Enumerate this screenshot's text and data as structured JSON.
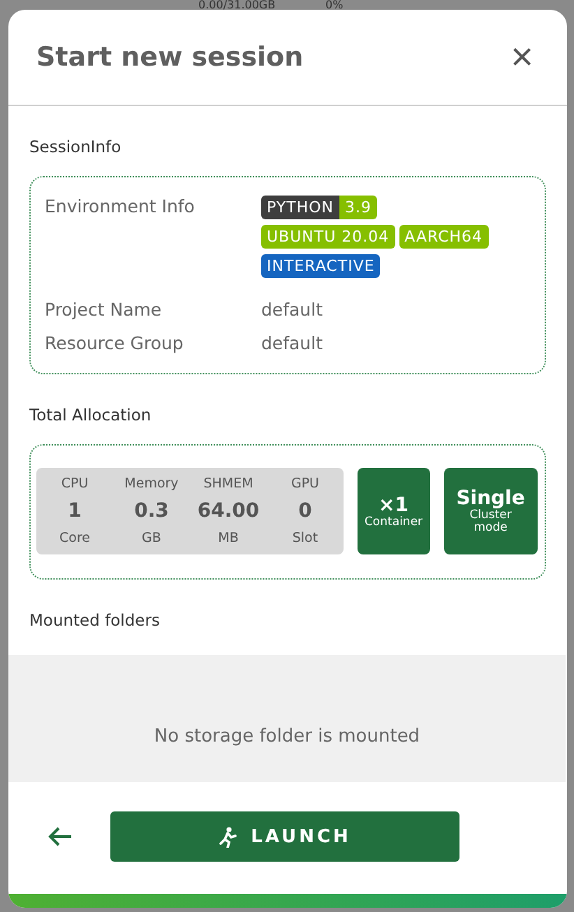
{
  "background": {
    "texts": [
      "0.00/31.00GB",
      "0%"
    ]
  },
  "dialog": {
    "title": "Start new session",
    "close_symbol": "×"
  },
  "session_info": {
    "heading": "SessionInfo",
    "environment": {
      "label": "Environment Info",
      "tag_rows": [
        {
          "tags": [
            {
              "segments": [
                {
                  "text": "PYTHON",
                  "color": "#3e3e3e"
                },
                {
                  "text": "3.9",
                  "color": "#86bf00"
                }
              ]
            }
          ]
        },
        {
          "tags": [
            {
              "segments": [
                {
                  "text": "UBUNTU 20.04",
                  "color": "#86bf00"
                }
              ]
            },
            {
              "segments": [
                {
                  "text": "AARCH64",
                  "color": "#86bf00"
                }
              ]
            }
          ]
        },
        {
          "tags": [
            {
              "segments": [
                {
                  "text": "INTERACTIVE",
                  "color": "#1565c0"
                }
              ]
            }
          ]
        }
      ]
    },
    "fields": [
      {
        "label": "Project Name",
        "value": "default"
      },
      {
        "label": "Resource Group",
        "value": "default"
      }
    ]
  },
  "allocation": {
    "heading": "Total Allocation",
    "resources": [
      {
        "name": "CPU",
        "value": "1",
        "unit": "Core"
      },
      {
        "name": "Memory",
        "value": "0.3",
        "unit": "GB"
      },
      {
        "name": "SHMEM",
        "value": "64.00",
        "unit": "MB"
      },
      {
        "name": "GPU",
        "value": "0",
        "unit": "Slot"
      }
    ],
    "container": {
      "value": "×1",
      "label": "Container"
    },
    "cluster": {
      "value": "Single",
      "label": "Cluster mode"
    }
  },
  "mounted_folders": {
    "heading": "Mounted folders",
    "empty_message": "No storage folder is mounted"
  },
  "footer": {
    "launch_label": "LAUNCH"
  }
}
